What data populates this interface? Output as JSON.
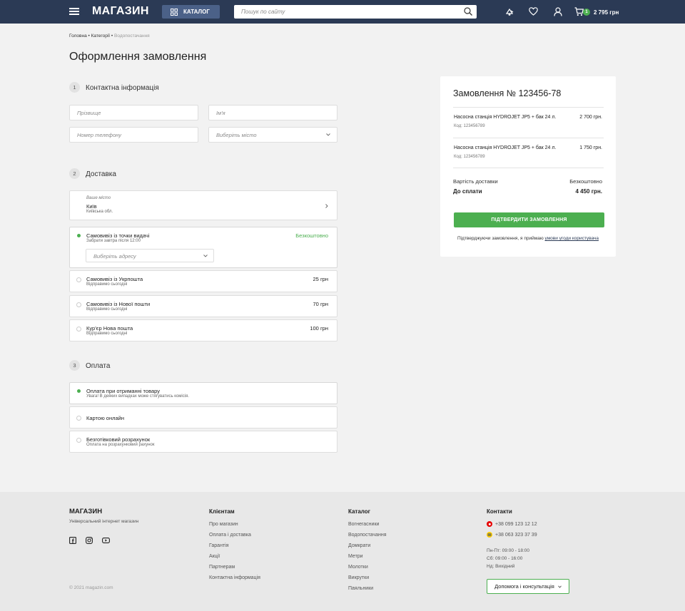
{
  "header": {
    "logo": "МАГАЗИН",
    "catalog_label": "КАТАЛОГ",
    "search_placeholder": "Пошук по сайту",
    "cart_count": "1",
    "cart_total": "2 795 грн"
  },
  "breadcrumb": {
    "items": [
      "Головна",
      "Категорії"
    ],
    "separator": "•",
    "current": "Водопостачання"
  },
  "page_title": "Оформлення замовлення",
  "contact": {
    "step": "1",
    "title": "Контактна інформація",
    "surname_placeholder": "Прізвище",
    "name_placeholder": "Ім'я",
    "phone_placeholder": "Номер телефону",
    "city_placeholder": "Виберіть місто"
  },
  "delivery": {
    "step": "2",
    "title": "Доставка",
    "city_label": "Ваше місто",
    "city_value": "Київ",
    "city_region": "Київська обл.",
    "selected_option": {
      "title": "Самовивіз із точки видачі",
      "sub": "Забрати завтра після 12:00",
      "price": "Безкоштовно",
      "address_placeholder": "Виберіть адресу"
    },
    "options": [
      {
        "title": "Самовивіз із Укрпошта",
        "sub": "Відправимо сьогодні",
        "price": "25 грн"
      },
      {
        "title": "Самовивіз із Нової пошти",
        "sub": "Відправимо сьогодні",
        "price": "70 грн"
      },
      {
        "title": "Кур'єр Нова пошта",
        "sub": "Відправимо сьогодні",
        "price": "100 грн"
      }
    ]
  },
  "payment": {
    "step": "3",
    "title": "Оплата",
    "options": [
      {
        "title": "Оплата при отриманні товару",
        "sub": "Увага! В деяких випадках може стягуватись комісія.",
        "selected": true
      },
      {
        "title": "Картою онлайн",
        "sub": "",
        "selected": false
      },
      {
        "title": "Безготівковий розрахунок",
        "sub": "Оплата на розрахунковий рахунок",
        "selected": false
      }
    ]
  },
  "summary": {
    "title": "Замовлення № 123456-78",
    "items": [
      {
        "name": "Насосна станція HYDROJET JP5 + бак 24 л.",
        "code": "Код: 123456789",
        "price": "2 700 грн."
      },
      {
        "name": "Насосна станція HYDROJET JP5 + бак 24 л.",
        "code": "Код: 123456789",
        "price": "1 750 грн."
      }
    ],
    "delivery_label": "Вартість доставки",
    "delivery_value": "Безкоштовно",
    "total_label": "До сплати",
    "total_value": "4 450 грн.",
    "confirm_label": "ПІДТВЕРДИТИ ЗАМОВЛЕННЯ",
    "terms_text": "Підтверджуючи замовлення, я приймаю",
    "terms_link": "умови угоди користувача"
  },
  "footer": {
    "logo": "МАГАЗИН",
    "tagline": "Універсальний інтернет магазин",
    "copyright": "© 2021 magazin.com",
    "clients_title": "Клієнтам",
    "clients_links": [
      "Про магазин",
      "Оплата і доставка",
      "Гарантія",
      "Акції",
      "Партнерам",
      "Контактна інформація"
    ],
    "catalog_title": "Каталог",
    "catalog_links": [
      "Вогнегасники",
      "Водопостачання",
      "Домкрати",
      "Метри",
      "Молотки",
      "Викрутки",
      "Паяльники"
    ],
    "contacts_title": "Контакти",
    "phones": [
      "+38 099 123 12 12",
      "+38 063 323 37 39"
    ],
    "hours": [
      "Пн-Пт: 09:00 - 18:00",
      "Сб: 09:00 - 16:00",
      "Нд: Вихідний"
    ],
    "help_label": "Допомога і консультація"
  },
  "colors": {
    "header_bg": "#2b3a55",
    "accent_green": "#4caf50",
    "catalog_btn": "#4b6188"
  }
}
